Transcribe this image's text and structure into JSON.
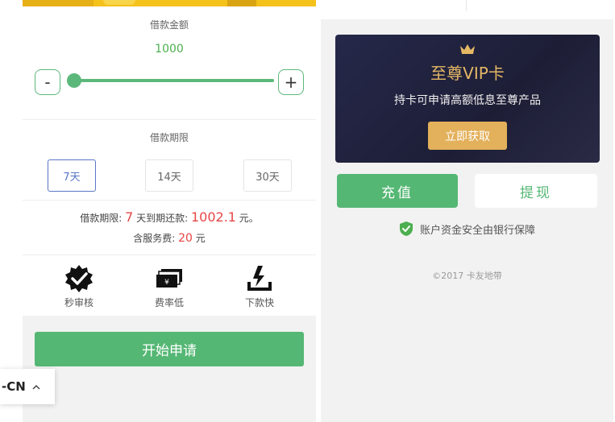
{
  "loan": {
    "amount_label": "借款金额",
    "amount_value": "1000",
    "minus_label": "-",
    "plus_label": "+",
    "term_label": "借款期限",
    "terms": [
      {
        "label": "7天",
        "active": true
      },
      {
        "label": "14天",
        "active": false
      },
      {
        "label": "30天",
        "active": false
      }
    ],
    "summary": {
      "term_prefix": "借款期限:",
      "term_days": "7",
      "due_prefix": "天到期还款:",
      "due_amount": "1002.1",
      "due_suffix": "元。",
      "fee_prefix": "含服务费:",
      "fee_amount": "20",
      "fee_suffix": "元"
    },
    "features": [
      {
        "icon": "check-badge-icon",
        "label": "秒审核"
      },
      {
        "icon": "cash-stack-icon",
        "label": "费率低"
      },
      {
        "icon": "download-fast-icon",
        "label": "下款快"
      }
    ],
    "apply_label": "开始申请",
    "slider_fraction": 0.0
  },
  "language": {
    "code": "-CN",
    "caret": "^"
  },
  "account": {
    "vip_title": "至尊VIP卡",
    "vip_subtitle": "持卡可申请高额低息至尊产品",
    "vip_button": "立即获取",
    "recharge_label": "充值",
    "withdraw_label": "提现",
    "safety_text": "账户资金安全由银行保障",
    "copyright": "©2017 卡友地带"
  },
  "colors": {
    "primary_green": "#55b774",
    "accent_gold": "#e3b05b",
    "highlight_red": "#e84545",
    "active_blue": "#5a76c8",
    "vip_dark": "#26284a"
  }
}
